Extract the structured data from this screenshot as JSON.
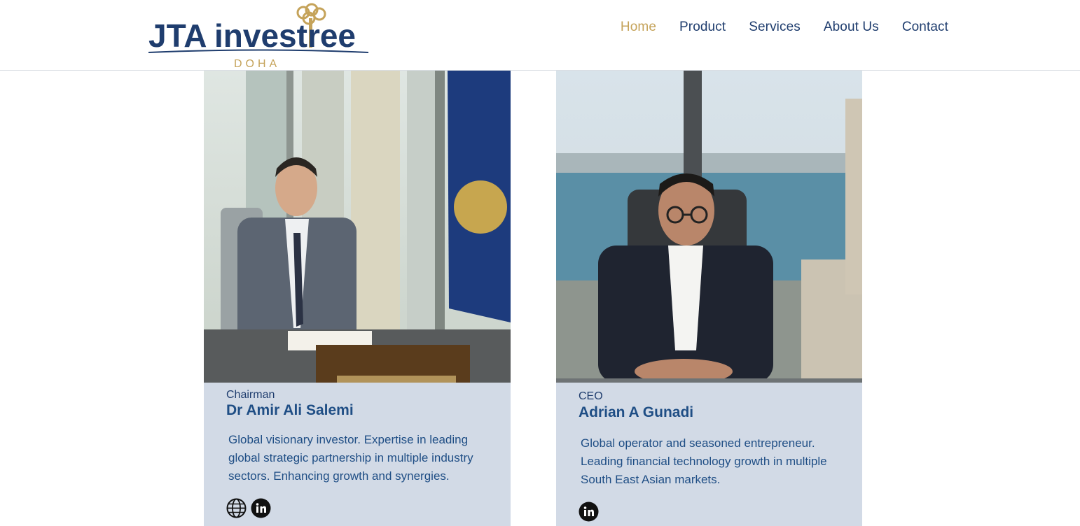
{
  "header": {
    "logo": {
      "wordmark_left": "JTA",
      "wordmark_right": "investree",
      "sub": "DOHA",
      "colors": {
        "navy": "#1f3d6e",
        "gold": "#c5a35a"
      }
    },
    "nav": [
      {
        "label": "Home",
        "active": true
      },
      {
        "label": "Product",
        "active": false
      },
      {
        "label": "Services",
        "active": false
      },
      {
        "label": "About Us",
        "active": false
      },
      {
        "label": "Contact",
        "active": false
      }
    ]
  },
  "team": [
    {
      "role": "Chairman",
      "name": "Dr Amir Ali Salemi",
      "bio": "Global visionary investor. Expertise in leading global strategic partnership in multiple industry sectors. Enhancing growth and synergies.",
      "socials": [
        "globe-icon",
        "linkedin-icon"
      ]
    },
    {
      "role": "CEO",
      "name": "Adrian A Gunadi",
      "bio": "Global operator and seasoned entrepreneur. Leading financial technology growth in multiple South East Asian markets.",
      "socials": [
        "linkedin-icon"
      ]
    }
  ],
  "colors": {
    "card_bg": "#d2dae6",
    "text_primary": "#1f4e85",
    "nav_active": "#c5a35a"
  }
}
